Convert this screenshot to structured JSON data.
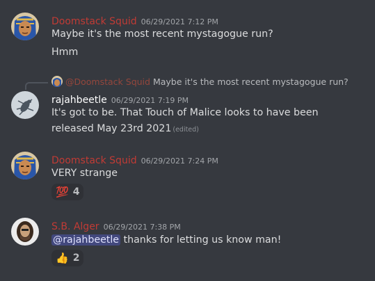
{
  "colors": {
    "background": "#36393f",
    "doomstack": "#c13b35",
    "rajah": "#ffffff",
    "alger": "#c13b35",
    "mention_bg": "#4a4f9a"
  },
  "messages": [
    {
      "author": "Doomstack Squid",
      "timestamp": "06/29/2021 7:12 PM",
      "lines": [
        "Maybe it's the most recent mystagogue run?",
        "Hmm"
      ]
    },
    {
      "reply": {
        "author": "@Doomstack Squid",
        "text": "Maybe it's the most recent mystagogue run?"
      },
      "author": "rajahbeetle",
      "timestamp": "06/29/2021 7:19 PM",
      "lines": [
        "It's got to be. That Touch of Malice looks to have been",
        "released May 23rd 2021"
      ],
      "edited": "(edited)"
    },
    {
      "author": "Doomstack Squid",
      "timestamp": "06/29/2021 7:24 PM",
      "lines": [
        "VERY strange"
      ],
      "reaction": {
        "emoji": "💯",
        "count": "4"
      }
    },
    {
      "author": "S.B. Alger",
      "timestamp": "06/29/2021 7:38 PM",
      "mention": "@rajahbeetle",
      "text_after_mention": " thanks for letting us know man!",
      "reaction": {
        "emoji": "👍",
        "count": "2"
      }
    }
  ]
}
